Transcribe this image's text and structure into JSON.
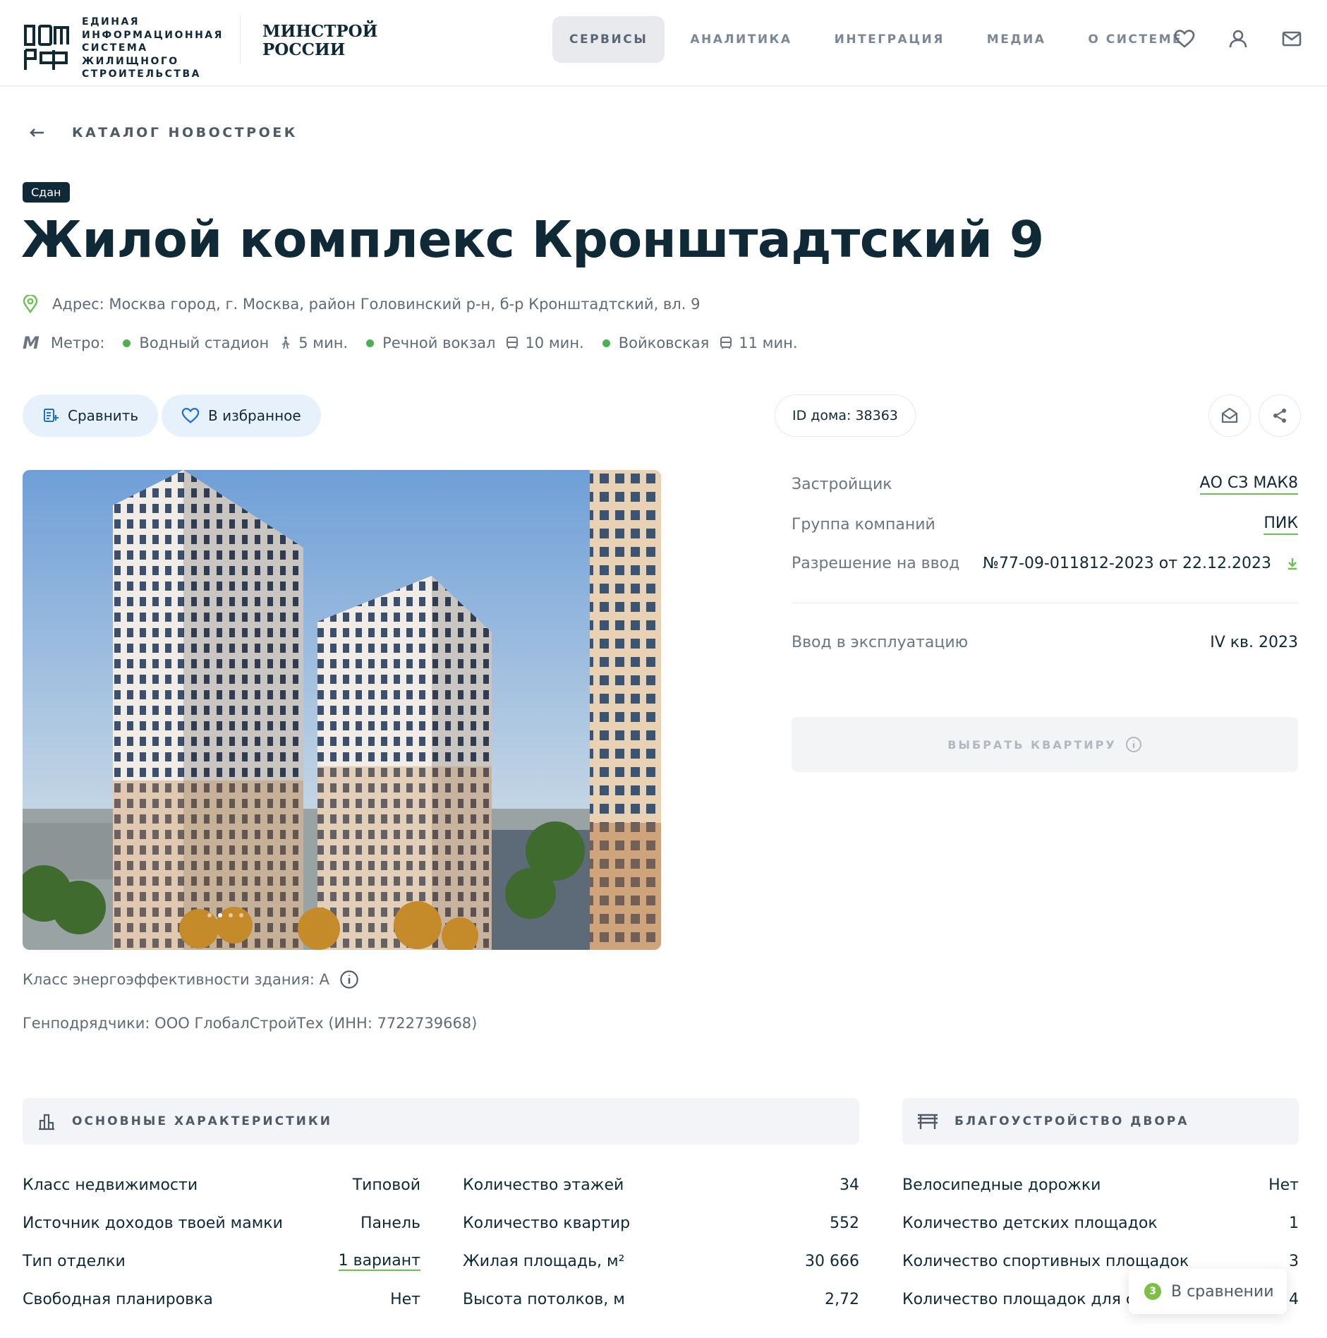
{
  "header": {
    "logo_lines": [
      "ЕДИНАЯ",
      "ИНФОРМАЦИОННАЯ",
      "СИСТЕМА ЖИЛИЩНОГО",
      "СТРОИТЕЛЬСТВА"
    ],
    "minstroy_lines": [
      "МИНСТРОЙ",
      "РОССИИ"
    ],
    "nav": [
      "СЕРВИСЫ",
      "АНАЛИТИКА",
      "ИНТЕГРАЦИЯ",
      "МЕДИА",
      "О СИСТЕМЕ"
    ],
    "nav_active": "СЕРВИСЫ",
    "icons": [
      "heart-icon",
      "user-icon",
      "mail-icon"
    ]
  },
  "breadcrumb": {
    "label": "КАТАЛОГ НОВОСТРОЕК"
  },
  "status": "Сдан",
  "title": "Жилой комплекс Кронштадтский 9",
  "address": "Адрес: Москва город, г. Москва, район Головинский р-н, б-р Кронштадтский, вл. 9",
  "metro": {
    "label": "Метро:",
    "stations": [
      {
        "name": "Водный стадион",
        "mode": "walk",
        "time": "5 мин."
      },
      {
        "name": "Речной вокзал",
        "mode": "bus",
        "time": "10 мин."
      },
      {
        "name": "Войковская",
        "mode": "bus",
        "time": "11 мин."
      }
    ]
  },
  "actions": {
    "compare": "Сравнить",
    "favorite": "В избранное",
    "house_id": "ID дома: 38363"
  },
  "details": {
    "developer_label": "Застройщик",
    "developer_value": "АО СЗ МАК8",
    "group_label": "Группа компаний",
    "group_value": "ПИК",
    "permit_label": "Разрешение на ввод",
    "permit_value": "№77-09-011812-2023 от 22.12.2023",
    "commission_label": "Ввод в эксплуатацию",
    "commission_value": "IV кв. 2023",
    "choose_button": "ВЫБРАТЬ КВАРТИРУ"
  },
  "energy": "Класс энергоэффективности здания: А",
  "contractor": "Генподрядчики: ООО ГлобалСтройТех (ИНН: 7722739668)",
  "sections": {
    "main": "ОСНОВНЫЕ ХАРАКТЕРИСТИКИ",
    "yard": "БЛАГОУСТРОЙСТВО ДВОРА"
  },
  "characteristics": {
    "col1": [
      {
        "k": "Класс недвижимости",
        "v": "Типовой"
      },
      {
        "k": "Источник доходов твоей мамки",
        "v": "Панель"
      },
      {
        "k": "Тип отделки",
        "v": "1 вариант"
      },
      {
        "k": "Свободная планировка",
        "v": "Нет"
      }
    ],
    "col2": [
      {
        "k": "Количество этажей",
        "v": "34"
      },
      {
        "k": "Количество квартир",
        "v": "552"
      },
      {
        "k": "Жилая площадь, м²",
        "v": "30 666"
      },
      {
        "k": "Высота потолков, м",
        "v": "2,72"
      }
    ],
    "col3": [
      {
        "k": "Велосипедные дорожки",
        "v": "Нет"
      },
      {
        "k": "Количество детских площадок",
        "v": "1"
      },
      {
        "k": "Количество спортивных площадок",
        "v": "3"
      },
      {
        "k": "Количество площадок для сбо",
        "v": "4"
      }
    ]
  },
  "compare_float": {
    "count": "3",
    "label": "В сравнении"
  },
  "colors": {
    "accent_green": "#6cbf50",
    "dark": "#0f2a36",
    "metro_dot": "#4caf50"
  }
}
